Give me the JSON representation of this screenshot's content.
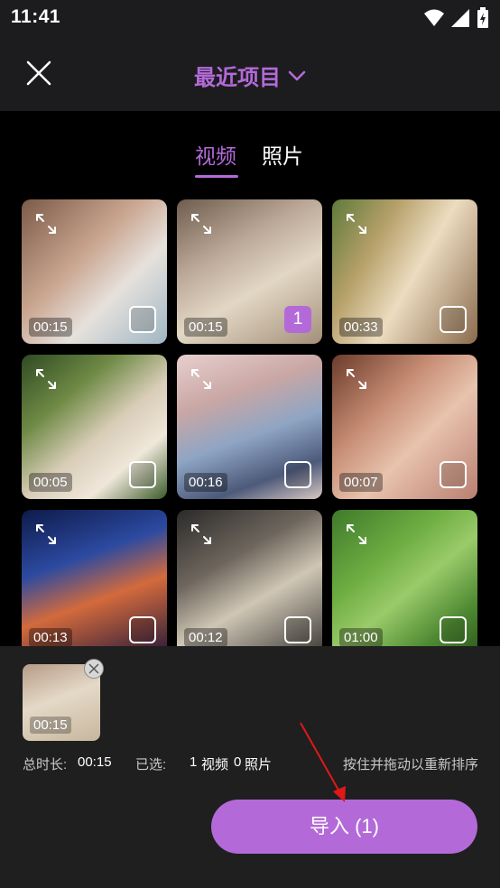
{
  "status_bar": {
    "time": "11:41"
  },
  "header": {
    "title": "最近项目"
  },
  "tabs": [
    {
      "label": "视频"
    },
    {
      "label": "照片"
    }
  ],
  "media_items": [
    {
      "duration": "00:15",
      "selected": false,
      "selection_number": ""
    },
    {
      "duration": "00:15",
      "selected": true,
      "selection_number": "1"
    },
    {
      "duration": "00:33",
      "selected": false,
      "selection_number": ""
    },
    {
      "duration": "00:05",
      "selected": false,
      "selection_number": ""
    },
    {
      "duration": "00:16",
      "selected": false,
      "selection_number": ""
    },
    {
      "duration": "00:07",
      "selected": false,
      "selection_number": ""
    },
    {
      "duration": "00:13",
      "selected": false,
      "selection_number": ""
    },
    {
      "duration": "00:12",
      "selected": false,
      "selection_number": ""
    },
    {
      "duration": "01:00",
      "selected": false,
      "selection_number": ""
    }
  ],
  "selection_panel": {
    "thumb_duration": "00:15",
    "total_duration_label": "总时长:",
    "total_duration_value": "00:15",
    "selected_label": "已选:",
    "video_count": "1",
    "video_label": "视频",
    "photo_count": "0",
    "photo_label": "照片",
    "hint": "按住并拖动以重新排序",
    "import_button": "导入 (1)"
  },
  "colors": {
    "accent": "#b36ad8",
    "panel": "#1f1f1f",
    "background": "#000000"
  }
}
